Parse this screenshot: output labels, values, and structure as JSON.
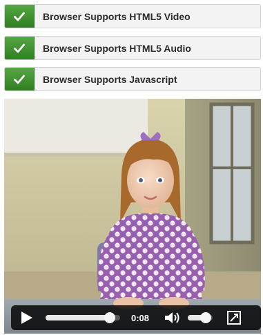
{
  "checks": [
    {
      "label": "Browser Supports HTML5 Video",
      "icon": "checkmark-icon",
      "status_color": "#3f9530"
    },
    {
      "label": "Browser Supports HTML5 Audio",
      "icon": "checkmark-icon",
      "status_color": "#3f9530"
    },
    {
      "label": "Browser Supports Javascript",
      "icon": "checkmark-icon",
      "status_color": "#3f9530"
    }
  ],
  "player": {
    "time": "0:08",
    "progress": 0.86,
    "volume": 0.72,
    "icons": {
      "play": "play-icon",
      "volume": "volume-icon",
      "fullscreen": "fullscreen-icon"
    }
  }
}
